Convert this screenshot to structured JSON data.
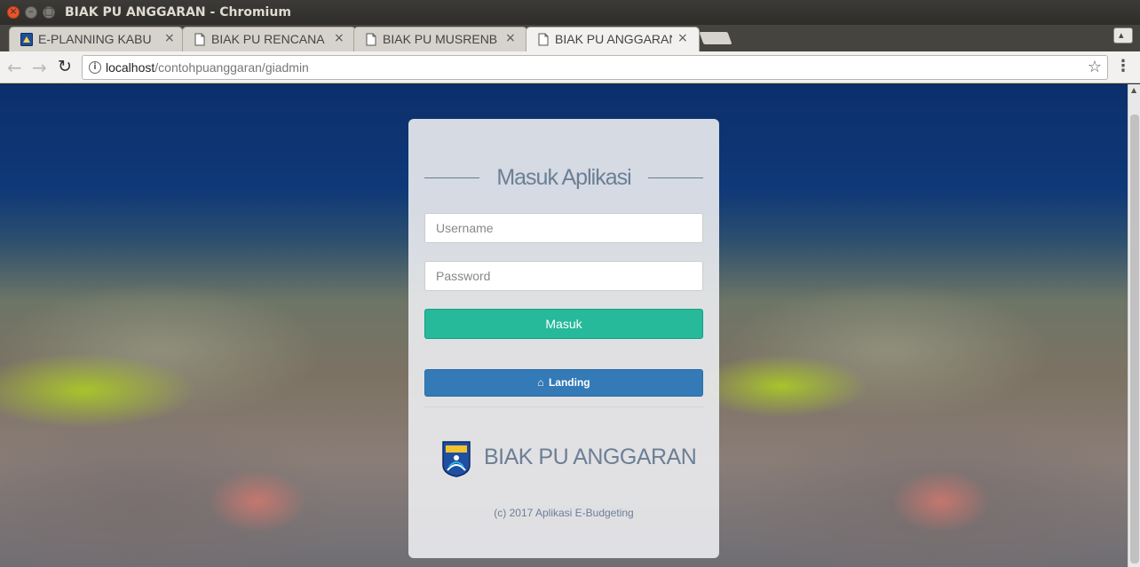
{
  "window": {
    "title": "BIAK PU ANGGARAN - Chromium",
    "close_glyph": "×",
    "minimize_glyph": "–",
    "maximize_glyph": "□"
  },
  "tabs": [
    {
      "label": "E-PLANNING KABU",
      "favicon": "site-logo-icon",
      "active": false
    },
    {
      "label": "BIAK PU RENCANA",
      "favicon": "page-icon",
      "active": false
    },
    {
      "label": "BIAK PU MUSRENB",
      "favicon": "page-icon",
      "active": false
    },
    {
      "label": "BIAK PU ANGGARAN",
      "favicon": "page-icon",
      "active": true
    }
  ],
  "tab_close_glyph": "×",
  "toolbar": {
    "back_glyph": "←",
    "forward_glyph": "→",
    "reload_glyph": "↻",
    "url_host": "localhost",
    "url_path": "/contohpuanggaran/giadmin",
    "info_glyph": "i",
    "star_glyph": "☆",
    "menu_glyph": "⋮",
    "profile_glyph": "▴"
  },
  "login": {
    "title": "Masuk Aplikasi",
    "username_placeholder": "Username",
    "password_placeholder": "Password",
    "submit_label": "Masuk",
    "landing_label": "Landing",
    "home_glyph": "⌂",
    "brand_name": "BIAK PU ANGGARAN",
    "copyright": "(c) 2017 Aplikasi E-Budgeting"
  },
  "colors": {
    "submit_bg": "#26b99a",
    "landing_bg": "#337ab7",
    "text_accent": "#6c7f95",
    "close_button": "#e9542c"
  },
  "icons": [
    "close-window-icon",
    "minimize-window-icon",
    "maximize-window-icon",
    "page-icon",
    "back-arrow-icon",
    "forward-arrow-icon",
    "reload-icon",
    "info-icon",
    "star-icon",
    "menu-icon",
    "home-icon",
    "regency-emblem-icon"
  ]
}
